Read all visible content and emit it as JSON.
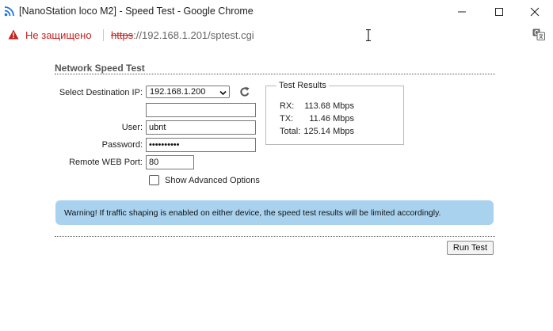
{
  "window": {
    "title": "[NanoStation loco M2] - Speed Test - Google Chrome"
  },
  "address_bar": {
    "security_text": "Не защищено",
    "url_scheme": "https",
    "url_rest": "://192.168.1.201/sptest.cgi"
  },
  "page": {
    "section_title": "Network Speed Test",
    "form": {
      "destination_label": "Select Destination IP:",
      "destination_selected": "192.168.1.200",
      "custom_ip_value": "",
      "user_label": "User:",
      "user_value": "ubnt",
      "password_label": "Password:",
      "password_value": "ubntubntub",
      "port_label": "Remote WEB Port:",
      "port_value": "80",
      "advanced_label": "Show Advanced Options",
      "advanced_checked": false
    },
    "results": {
      "legend": "Test Results",
      "rx_label": "RX:",
      "rx_value": "113.68 Mbps",
      "tx_label": "TX:",
      "tx_value": "11.46 Mbps",
      "total_label": "Total:",
      "total_value": "125.14 Mbps"
    },
    "warning": "Warning! If traffic shaping is enabled on either device, the speed test results will be limited accordingly.",
    "run_button": "Run Test"
  },
  "colors": {
    "warning_bg": "#a9d2ef",
    "insecure_red": "#c5221f",
    "chrome_blue": "#1a73e8"
  },
  "icons": {
    "app": "rss-wifi-icon",
    "security": "warning-triangle-icon",
    "refresh": "refresh-icon",
    "translate": "translate-icon"
  }
}
